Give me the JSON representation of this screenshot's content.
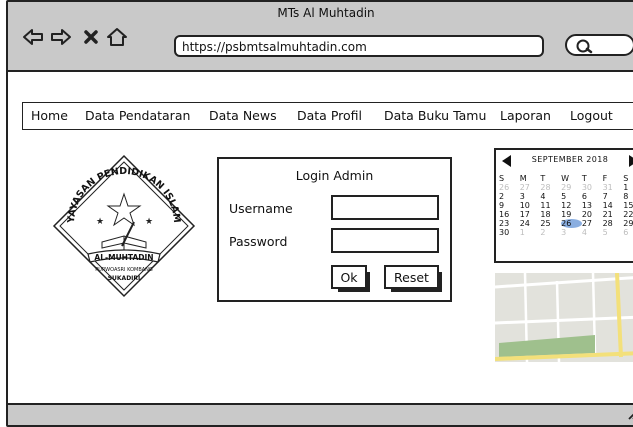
{
  "window": {
    "title": "MTs Al Muhtadin"
  },
  "browser": {
    "url": "https://psbmtsalmuhtadin.com",
    "search_value": ""
  },
  "menu": {
    "items": [
      {
        "label": "Home"
      },
      {
        "label": "Data Pendataran"
      },
      {
        "label": "Data News"
      },
      {
        "label": "Data Profil"
      },
      {
        "label": "Data Buku Tamu"
      },
      {
        "label": "Laporan"
      },
      {
        "label": "Logout"
      }
    ]
  },
  "logo": {
    "top_text": "YAYASAN PENDIDIKAN ISLAM",
    "banner_text": "AL-MUHTADIN",
    "sub_text_1": "PURWOASRI KOMBANG",
    "sub_text_2": "SUKADIRI"
  },
  "login": {
    "title": "Login Admin",
    "username_label": "Username",
    "password_label": "Password",
    "username_value": "",
    "password_value": "",
    "ok_label": "Ok",
    "reset_label": "Reset"
  },
  "calendar": {
    "month_label": "SEPTEMBER 2018",
    "weekdays": [
      "S",
      "M",
      "T",
      "W",
      "T",
      "F",
      "S"
    ],
    "days": [
      {
        "d": "26",
        "dim": true
      },
      {
        "d": "27",
        "dim": true
      },
      {
        "d": "28",
        "dim": true
      },
      {
        "d": "29",
        "dim": true
      },
      {
        "d": "30",
        "dim": true
      },
      {
        "d": "31",
        "dim": true
      },
      {
        "d": "1",
        "dim": false
      },
      {
        "d": "2",
        "dim": false
      },
      {
        "d": "3",
        "dim": false
      },
      {
        "d": "4",
        "dim": false
      },
      {
        "d": "5",
        "dim": false
      },
      {
        "d": "6",
        "dim": false
      },
      {
        "d": "7",
        "dim": false
      },
      {
        "d": "8",
        "dim": false
      },
      {
        "d": "9",
        "dim": false
      },
      {
        "d": "10",
        "dim": false
      },
      {
        "d": "11",
        "dim": false
      },
      {
        "d": "12",
        "dim": false
      },
      {
        "d": "13",
        "dim": false
      },
      {
        "d": "14",
        "dim": false
      },
      {
        "d": "15",
        "dim": false
      },
      {
        "d": "16",
        "dim": false
      },
      {
        "d": "17",
        "dim": false
      },
      {
        "d": "18",
        "dim": false
      },
      {
        "d": "19",
        "dim": false
      },
      {
        "d": "20",
        "dim": false
      },
      {
        "d": "21",
        "dim": false
      },
      {
        "d": "22",
        "dim": false
      },
      {
        "d": "23",
        "dim": false
      },
      {
        "d": "24",
        "dim": false
      },
      {
        "d": "25",
        "dim": false
      },
      {
        "d": "26",
        "dim": false,
        "selected": true
      },
      {
        "d": "27",
        "dim": false
      },
      {
        "d": "28",
        "dim": false
      },
      {
        "d": "29",
        "dim": false
      },
      {
        "d": "30",
        "dim": false
      },
      {
        "d": "1",
        "dim": true
      },
      {
        "d": "2",
        "dim": true
      },
      {
        "d": "3",
        "dim": true
      },
      {
        "d": "4",
        "dim": true
      },
      {
        "d": "5",
        "dim": true
      },
      {
        "d": "6",
        "dim": true
      }
    ]
  },
  "colors": {
    "chrome": "#c9c9c9",
    "selected_day": "#8aaee0",
    "map_road": "#f3e07a",
    "map_park": "#9fc08d"
  }
}
